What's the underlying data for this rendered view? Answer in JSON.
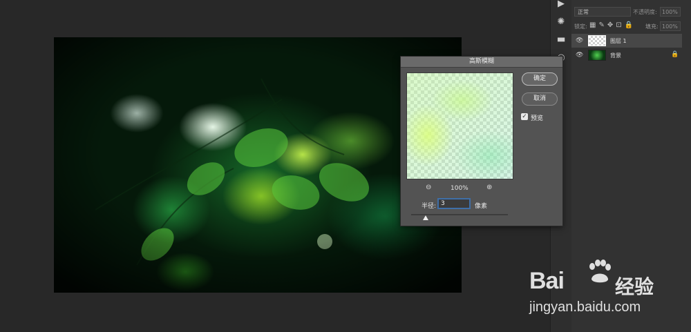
{
  "canvas": {
    "description_icon": "photo-leaves"
  },
  "tool_strip": {
    "icons": [
      "play-icon",
      "sun-icon",
      "levels-icon",
      "circle-icon"
    ]
  },
  "layers_panel": {
    "blend_mode": "正常",
    "opacity_label": "不透明度:",
    "opacity_value": "100%",
    "lock_label": "锁定:",
    "fill_label": "填充:",
    "fill_value": "100%",
    "layers": [
      {
        "name": "图层 1",
        "selected": true,
        "thumb": "transparent"
      },
      {
        "name": "背景",
        "selected": false,
        "thumb": "photo",
        "locked": true
      }
    ]
  },
  "dialog": {
    "title": "高斯模糊",
    "ok_label": "确定",
    "cancel_label": "取消",
    "preview_label": "预览",
    "preview_checked": true,
    "zoom_level": "100%",
    "radius_label": "半径:",
    "radius_value": "3",
    "radius_unit": "像素"
  },
  "watermark": {
    "logo_text": "Bai",
    "logo_cn": "经验",
    "url": "jingyan.baidu.com"
  }
}
